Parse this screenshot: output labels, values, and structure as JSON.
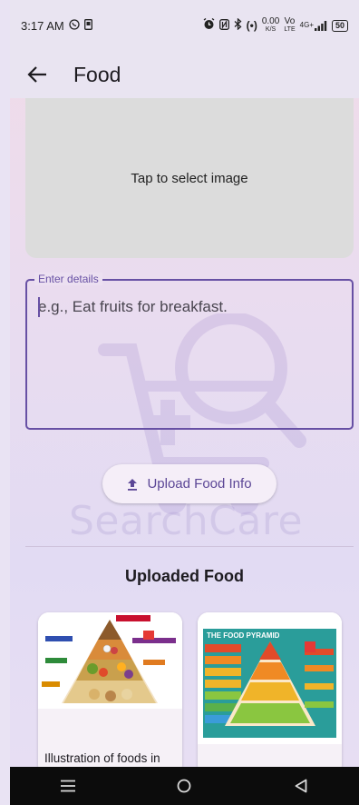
{
  "status_bar": {
    "time": "3:17 AM",
    "net_speed": "0.00",
    "net_unit": "K/S",
    "vo": "Vo",
    "lte": "LTE",
    "signal": "4G+",
    "battery": "50"
  },
  "app_bar": {
    "title": "Food"
  },
  "image_picker": {
    "label": "Tap to select image"
  },
  "details_field": {
    "label": "Enter details",
    "placeholder": "e.g., Eat fruits for breakfast.",
    "value": ""
  },
  "watermark": {
    "text": "SearchCare"
  },
  "upload_button": {
    "label": "Upload Food Info"
  },
  "uploaded_section": {
    "title": "Uploaded Food",
    "cards": [
      {
        "caption": "Illustration of foods in",
        "image": "food-pyramid-illustration"
      },
      {
        "caption": "",
        "image": "the-food-pyramid-poster",
        "poster_title": "THE FOOD PYRAMID"
      }
    ]
  },
  "colors": {
    "accent": "#6750a4",
    "button_text": "#5b4696"
  }
}
